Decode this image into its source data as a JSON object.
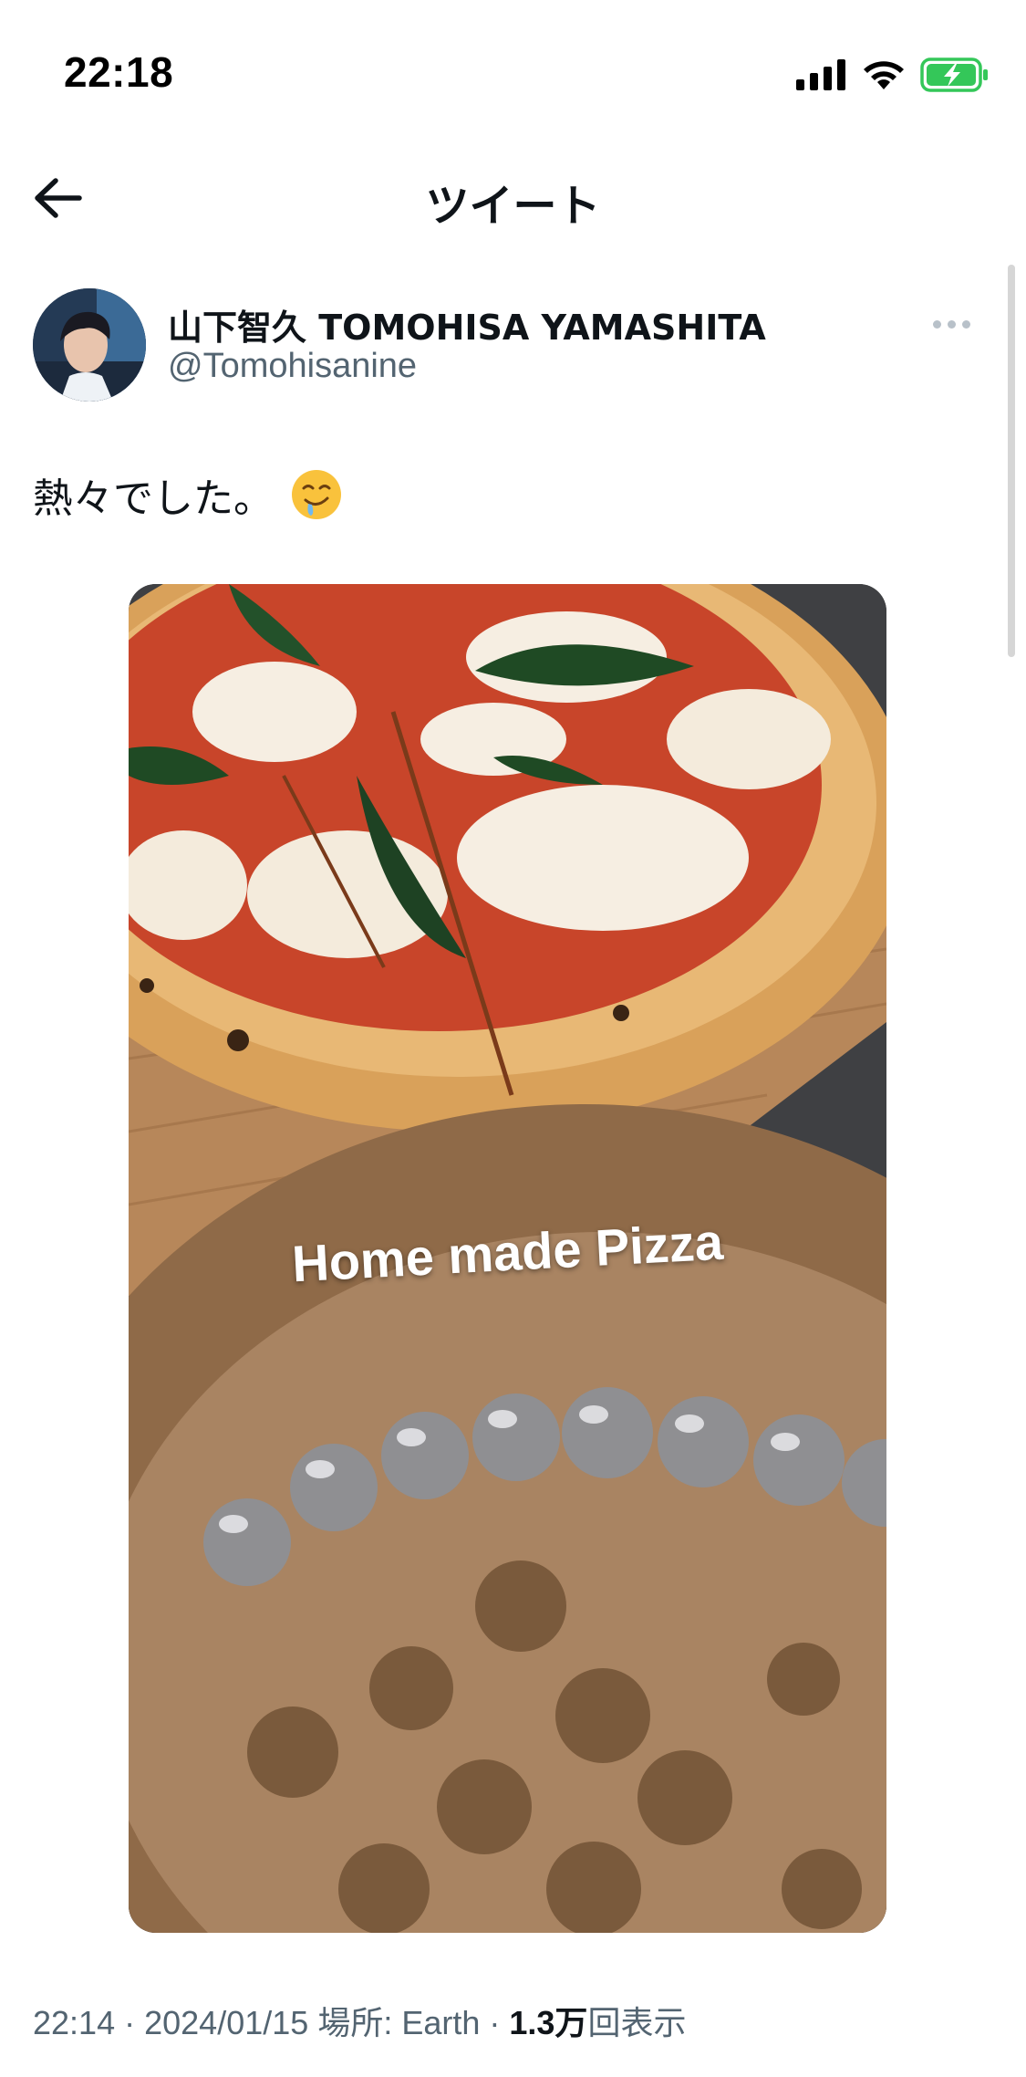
{
  "status_bar": {
    "time": "22:18",
    "icons": [
      "signal-icon",
      "wifi-icon",
      "battery-charging-icon"
    ],
    "battery_color": "#34c759"
  },
  "header": {
    "title": "ツイート",
    "back_icon": "arrow-left-icon"
  },
  "tweet": {
    "author": {
      "display_name": "山下智久 TOMOHISA YAMASHITA",
      "handle": "@Tomohisanine"
    },
    "text": "熱々でした。",
    "emoji": "drooling-face-emoji",
    "media": {
      "caption": "Home made Pizza"
    },
    "meta": {
      "time": "22:14",
      "date": "2024/01/15",
      "location_label": "場所: Earth",
      "views_count": "1.3万",
      "views_label": "回表示"
    }
  },
  "colors": {
    "text_primary": "#0f1419",
    "text_secondary": "#536471"
  }
}
